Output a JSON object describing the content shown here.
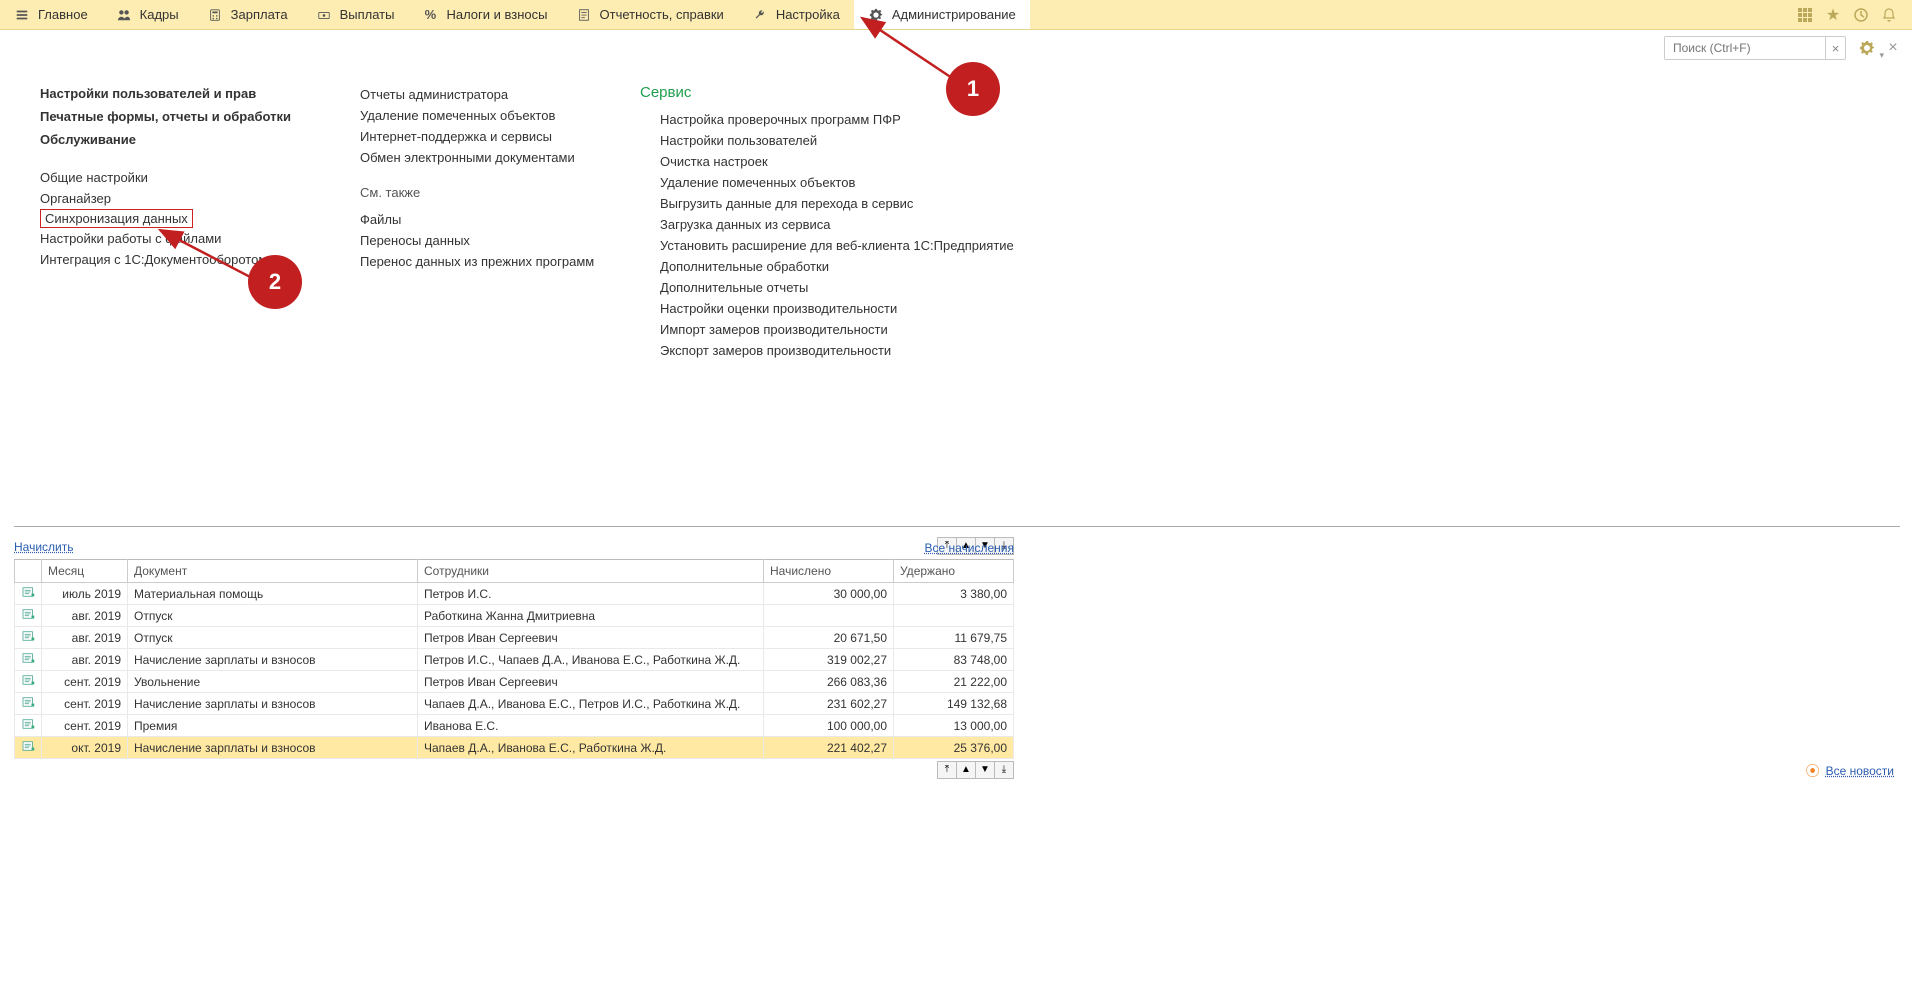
{
  "menu": {
    "items": [
      {
        "label": "Главное",
        "icon": "menu"
      },
      {
        "label": "Кадры",
        "icon": "people"
      },
      {
        "label": "Зарплата",
        "icon": "calc"
      },
      {
        "label": "Выплаты",
        "icon": "money"
      },
      {
        "label": "Налоги и взносы",
        "icon": "percent"
      },
      {
        "label": "Отчетность, справки",
        "icon": "report"
      },
      {
        "label": "Настройка",
        "icon": "wrench"
      },
      {
        "label": "Администрирование",
        "icon": "gear",
        "active": true
      }
    ]
  },
  "search": {
    "placeholder": "Поиск (Ctrl+F)"
  },
  "admin": {
    "col1": {
      "bold": [
        "Настройки пользователей и прав",
        "Печатные формы, отчеты и обработки",
        "Обслуживание"
      ],
      "links": [
        "Общие настройки",
        "Органайзер",
        "Синхронизация данных",
        "Настройки работы с файлами",
        "Интеграция с 1С:Документооборотом"
      ]
    },
    "col2": {
      "top": [
        "Отчеты администратора",
        "Удаление помеченных объектов",
        "Интернет-поддержка и сервисы",
        "Обмен электронными документами"
      ],
      "see_also_header": "См. также",
      "see_also": [
        "Файлы",
        "Переносы данных",
        "Перенос данных из прежних программ"
      ]
    },
    "service": {
      "title": "Сервис",
      "links": [
        "Настройка проверочных программ ПФР",
        "Настройки пользователей",
        "Очистка настроек",
        "Удаление помеченных объектов",
        "Выгрузить данные для перехода в сервис",
        "Загрузка данных из сервиса",
        "Установить расширение для веб-клиента 1С:Предприятие",
        "Дополнительные обработки",
        "Дополнительные отчеты",
        "Настройки оценки производительности",
        "Импорт замеров производительности",
        "Экспорт замеров производительности"
      ]
    }
  },
  "annot": {
    "one": "1",
    "two": "2"
  },
  "lower": {
    "accrue": "Начислить",
    "all_accruals": "Все начисления",
    "columns": {
      "month": "Месяц",
      "doc": "Документ",
      "emp": "Сотрудники",
      "accrued": "Начислено",
      "withheld": "Удержано"
    },
    "rows": [
      {
        "month": "июль 2019",
        "doc": "Материальная помощь",
        "emp": "Петров И.С.",
        "accrued": "30 000,00",
        "withheld": "3 380,00"
      },
      {
        "month": "авг. 2019",
        "doc": "Отпуск",
        "emp": "Работкина Жанна Дмитриевна",
        "accrued": "",
        "withheld": ""
      },
      {
        "month": "авг. 2019",
        "doc": "Отпуск",
        "emp": "Петров Иван Сергеевич",
        "accrued": "20 671,50",
        "withheld": "11 679,75"
      },
      {
        "month": "авг. 2019",
        "doc": "Начисление зарплаты и взносов",
        "emp": "Петров И.С., Чапаев Д.А., Иванова Е.С., Работкина Ж.Д.",
        "accrued": "319 002,27",
        "withheld": "83 748,00"
      },
      {
        "month": "сент. 2019",
        "doc": "Увольнение",
        "emp": "Петров Иван Сергеевич",
        "accrued": "266 083,36",
        "withheld": "21 222,00"
      },
      {
        "month": "сент. 2019",
        "doc": "Начисление зарплаты и взносов",
        "emp": "Чапаев Д.А., Иванова Е.С., Петров И.С., Работкина Ж.Д.",
        "accrued": "231 602,27",
        "withheld": "149 132,68"
      },
      {
        "month": "сент. 2019",
        "doc": "Премия",
        "emp": "Иванова Е.С.",
        "accrued": "100 000,00",
        "withheld": "13 000,00"
      },
      {
        "month": "окт. 2019",
        "doc": "Начисление зарплаты и взносов",
        "emp": "Чапаев Д.А., Иванова Е.С., Работкина Ж.Д.",
        "accrued": "221 402,27",
        "withheld": "25 376,00",
        "selected": true
      }
    ],
    "all_news": "Все новости"
  }
}
